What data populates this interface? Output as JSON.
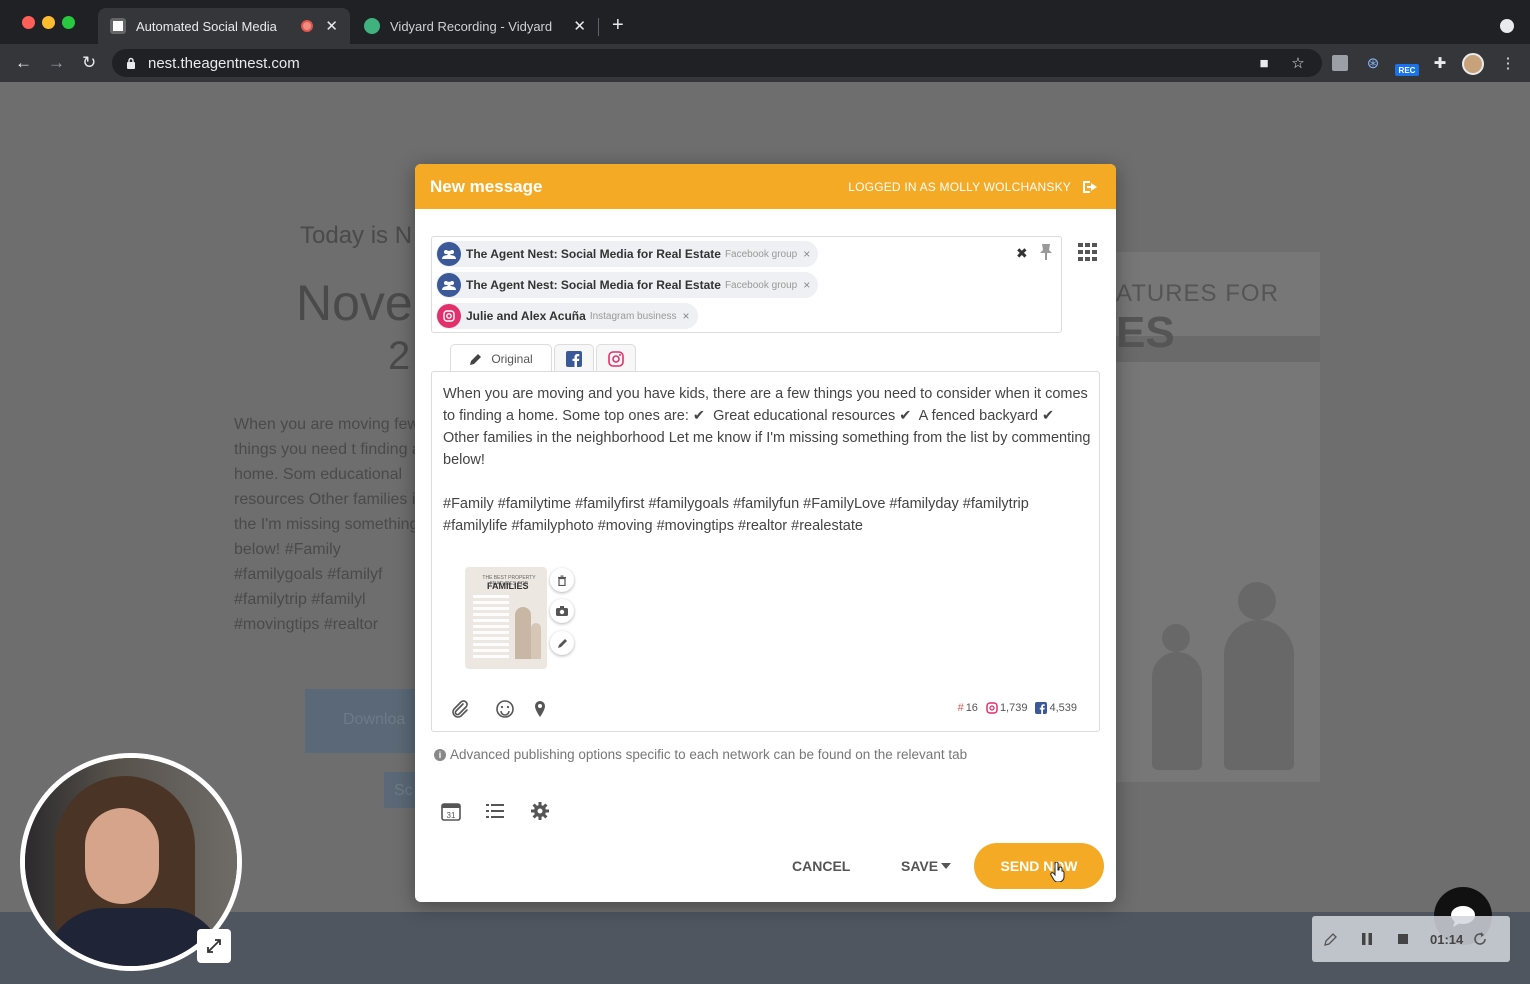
{
  "browser": {
    "tabs": [
      {
        "title": "Automated Social Media",
        "active": true,
        "recording": true
      },
      {
        "title": "Vidyard Recording - Vidyard",
        "active": false
      }
    ],
    "url": "nest.theagentnest.com",
    "rec_badge": "REC"
  },
  "background_page": {
    "today": "Today is N",
    "month": "Nove",
    "year_fragment": "2",
    "paragraph": "When you are moving  few things you need t finding a home. Som educational resources Other families in the  I'm missing something below!     #Family #familygoals  #familyf #familytrip    #familyl #movingtips #realtor",
    "download_btn": "Downloa",
    "sc_btn": "Sc",
    "features": "ATURES FOR",
    "es": "ES"
  },
  "modal": {
    "title": "New message",
    "logged_in": "LOGGED IN AS MOLLY WOLCHANSKY",
    "recipients": [
      {
        "name": "The Agent Nest: Social Media for Real Estate",
        "type": "Facebook group",
        "network": "facebook"
      },
      {
        "name": "The Agent Nest: Social Media for Real Estate",
        "type": "Facebook group",
        "network": "facebook"
      },
      {
        "name": "Julie and Alex Acuña",
        "type": "Instagram business",
        "network": "instagram"
      }
    ],
    "remove_glyph": "×",
    "clear_all": "✖",
    "tabs": {
      "original": "Original"
    },
    "message": "When you are moving and you have kids, there are a few things you need to consider when it comes to finding a home. Some top ones are: ✔  Great educational resources ✔  A fenced backyard ✔  Other families in the neighborhood Let me know if I'm missing something from the list by commenting below!\n\n#Family #familytime #familyfirst #familygoals #familyfun #FamilyLove #familyday #familytrip #familylife #familyphoto #moving #movingtips #realtor #realestate",
    "thumbnail": {
      "top_text": "THE BEST PROPERTY FEATURES FOR",
      "title": "FAMILIES"
    },
    "counters": {
      "hashtags": "16",
      "instagram": "1,739",
      "facebook": "4,539"
    },
    "advanced_note": "Advanced publishing options specific to each network can be found on the relevant tab",
    "buttons": {
      "cancel": "CANCEL",
      "save": "SAVE",
      "send": "SEND NOW"
    }
  },
  "recorder": {
    "time": "01:14"
  },
  "colors": {
    "accent": "#f4aa25",
    "facebook": "#3b5998",
    "instagram": "#e1306c"
  }
}
